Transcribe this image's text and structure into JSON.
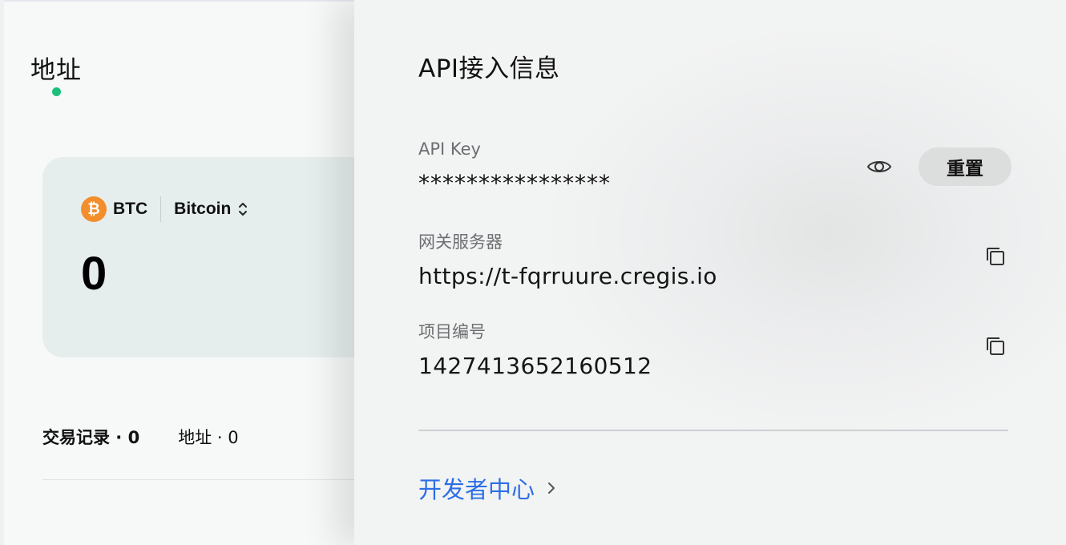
{
  "page": {
    "title": "地址"
  },
  "balance_card": {
    "coin_symbol": "BTC",
    "coin_icon_glyph": "₿",
    "coin_name": "Bitcoin",
    "balance": "0"
  },
  "tabs": [
    {
      "label": "交易记录 · 0",
      "active": true
    },
    {
      "label": "地址 · 0",
      "active": false
    }
  ],
  "drawer": {
    "title": "API接入信息",
    "api_key": {
      "label": "API Key",
      "value": "****************",
      "reset_label": "重置"
    },
    "gateway": {
      "label": "网关服务器",
      "value": "https://t-fqrruure.cregis.io"
    },
    "project_id": {
      "label": "项目编号",
      "value": "1427413652160512"
    },
    "developer_link": "开发者中心"
  },
  "colors": {
    "accent_green": "#1abf7a",
    "btc_orange": "#f38e2c",
    "link_blue": "#2c6fe6",
    "card_bg": "#e6eeed"
  },
  "icons": [
    "bitcoin-icon",
    "chevron-up-down-icon",
    "eye-icon",
    "copy-icon",
    "chevron-right-icon"
  ]
}
